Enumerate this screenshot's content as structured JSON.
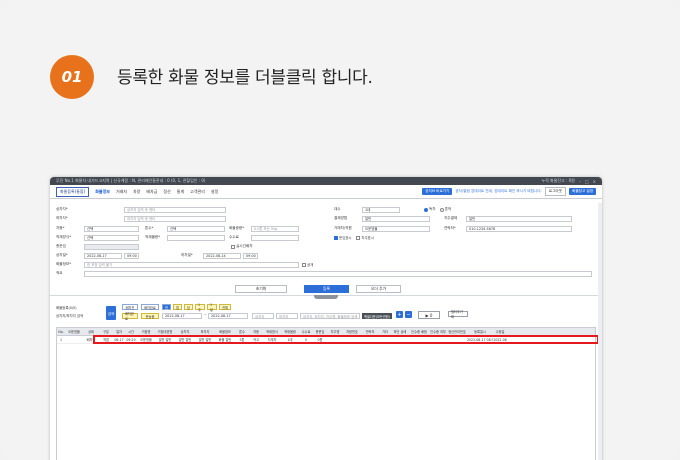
{
  "step": {
    "number": "01",
    "title": "등록한 화물 정보를 더블클릭 합니다."
  },
  "titlebar": {
    "left": "무진 No.1 화물차 내가드고지역  |  신규계정 : N, 관리메인통관내 : 0 (0, 1, 관할입인 : 0)",
    "right": "누적 화물잔고 : 0원"
  },
  "menubar": {
    "tab": "화물등록(통합)",
    "items": [
      "화물정보",
      "거래처",
      "차량",
      "배차금",
      "정산",
      "통계",
      "고객관리",
      "설정"
    ],
    "active_index": 0,
    "btn_notice": "공지M 바로가기",
    "notice": "공지/알림 업데이트 안내, 업데이트 확인 하시기 바랍니다.",
    "btn_logout": "로그아웃",
    "btn_settings": "화물창고 설정"
  },
  "form": {
    "shipper": {
      "label": "상차지*",
      "placeholder": "상차지 입력 후 엔터"
    },
    "consignee": {
      "label": "하차지*",
      "placeholder": "하차지 입력 후 엔터"
    },
    "car": {
      "label": "차종*",
      "value": "선택"
    },
    "ton": {
      "label": "톤수*",
      "value": "선택"
    },
    "cargo_weight": {
      "label": "화물중량*",
      "placeholder": "0.0톤 또는 0kg"
    },
    "load_method": {
      "label": "적재방식*",
      "value": "선택"
    },
    "load_count": {
      "label": "적재물량*"
    },
    "quantity": {
      "label": "수수료"
    },
    "sum": {
      "label": "총운임"
    },
    "allocation_check": "실시간배차",
    "load_date": {
      "label": "상차일*",
      "date": "2022-08-17",
      "time": "09:00"
    },
    "unload_date": {
      "label": "하차일*",
      "date": "2022-08-14",
      "time": "09:00"
    },
    "cargo_info": {
      "label": "화물정보*",
      "placeholder": "한 포장 입력 불가"
    },
    "cargo_check": "공개",
    "memo": {
      "label": "적요"
    },
    "agency": {
      "label": "대수",
      "value": "1대"
    },
    "mix_radio_1": "독차",
    "mix_radio_2": "혼적",
    "pay_method": {
      "label": "결제방법",
      "value": "일반"
    },
    "pay_method2": {
      "label": "차주결제",
      "value": "일반"
    },
    "contact_person": {
      "label": "거래처/직원",
      "value": "오운영물"
    },
    "contact_phone": {
      "label": "연락처*",
      "value": "010-1234-5678"
    },
    "check_a": "운임표시",
    "check_b": "차주표시"
  },
  "actions": {
    "reset": "초기화",
    "register": "등록",
    "open_more": "오더 추가"
  },
  "grid_toolbar": {
    "label_a": "화물등록(0/0)",
    "label_b": "상차지/하차지 검색",
    "search": "검색",
    "chips": [
      "배차전",
      "배차완료",
      "운송중",
      "하차완료"
    ],
    "chip_yellow": [
      "배차완료",
      "운송중",
      "하차완료"
    ],
    "date_from": "2022-08-17",
    "date_to": "2022-08-17",
    "filters": [
      "전",
      "접",
      "당",
      "1주",
      "1달",
      "전체"
    ],
    "combo_a": "상차지",
    "combo_b": "하차지",
    "combo_c": "상차지, 하차지, 차주명, 화물정보 검색",
    "dark_btn": "엑셀다운(모든권한)",
    "play_label": "0",
    "reset_btn": "필터초기화"
  },
  "table": {
    "headers": [
      "No.",
      "오운영물",
      "상태",
      "구분",
      "일자",
      "시간",
      "거점명",
      "거점대표명",
      "상차지",
      "하차지",
      "화물정보",
      "톤수",
      "차종",
      "적재방식",
      "적재물량",
      "수수료",
      "총운임",
      "차주명",
      "차량번호",
      "연락처",
      "기타",
      "하단 상태",
      "인수증 배정",
      "인수증 여부",
      "정산관리번호",
      "등록일시",
      "수정일"
    ],
    "row": [
      "1",
      "",
      "배차전",
      "직접",
      "08-17",
      "09:20",
      "오운영물",
      "일반 일반",
      "일반 일반",
      "일반 일반",
      "화물 일반",
      "5톤",
      "카고",
      "지게차",
      "1대",
      "0",
      "0원",
      "",
      "",
      "",
      "",
      "",
      "",
      "",
      "",
      "2022-08-17 08:30",
      "2022-08"
    ]
  }
}
